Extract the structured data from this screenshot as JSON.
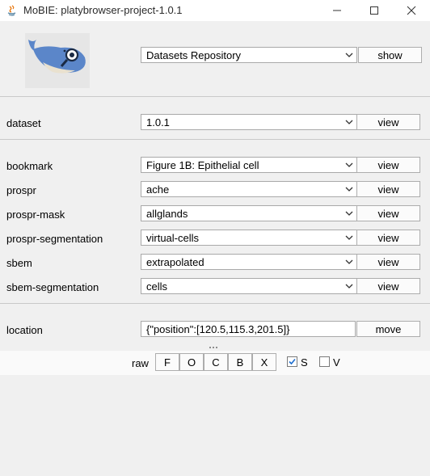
{
  "window": {
    "title": "MoBIE: platybrowser-project-1.0.1"
  },
  "source": {
    "selected": "Datasets Repository",
    "button": "show"
  },
  "dataset": {
    "label": "dataset",
    "selected": "1.0.1",
    "button": "view"
  },
  "layers": [
    {
      "label": "bookmark",
      "selected": "Figure 1B: Epithelial cell",
      "button": "view"
    },
    {
      "label": "prospr",
      "selected": "ache",
      "button": "view"
    },
    {
      "label": "prospr-mask",
      "selected": "allglands",
      "button": "view"
    },
    {
      "label": "prospr-segmentation",
      "selected": "virtual-cells",
      "button": "view"
    },
    {
      "label": "sbem",
      "selected": "extrapolated",
      "button": "view"
    },
    {
      "label": "sbem-segmentation",
      "selected": "cells",
      "button": "view"
    }
  ],
  "location": {
    "label": "location",
    "value": "{\"position\":[120.5,115.3,201.5]}",
    "button": "move"
  },
  "view_controls": {
    "raw_label": "raw",
    "buttons": [
      "F",
      "O",
      "C",
      "B",
      "X"
    ],
    "checkbox_s": {
      "label": "S",
      "checked": true
    },
    "checkbox_v": {
      "label": "V",
      "checked": false
    }
  },
  "colors": {
    "check": "#1e6fd0",
    "logo_whale": "#5b86c9"
  }
}
